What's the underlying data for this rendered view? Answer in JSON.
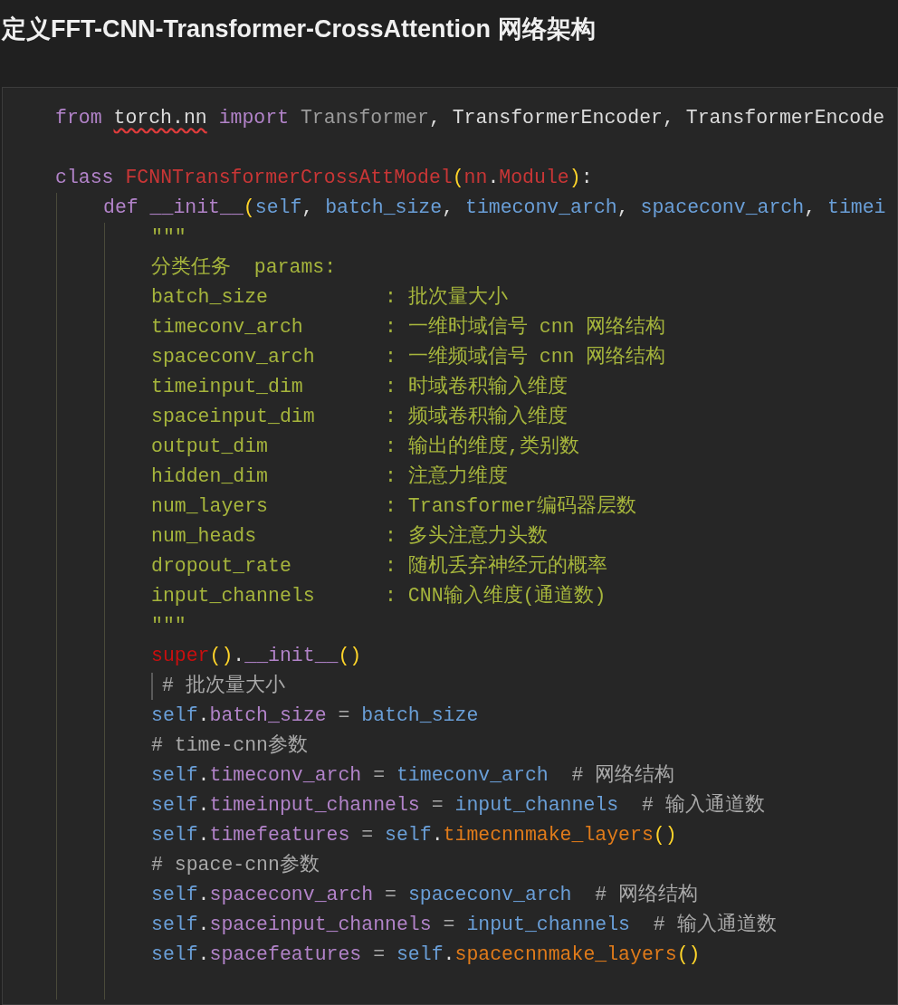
{
  "title": "定义FFT-CNN-Transformer-CrossAttention 网络架构",
  "code": [
    {
      "kind": "code",
      "tokens": [
        {
          "kind": "keyword",
          "text": "from "
        },
        {
          "kind": "error",
          "text": "torch.nn"
        },
        {
          "kind": "keyword",
          "text": " import "
        },
        {
          "kind": "unused",
          "text": "Transformer"
        },
        {
          "kind": "plain",
          "text": ", TransformerEncoder, TransformerEncode"
        }
      ]
    },
    {
      "kind": "blank"
    },
    {
      "kind": "code",
      "tokens": [
        {
          "kind": "keyword",
          "text": "class "
        },
        {
          "kind": "classname",
          "text": "FCNNTransformerCrossAttModel"
        },
        {
          "kind": "paren",
          "text": "("
        },
        {
          "kind": "classname",
          "text": "nn"
        },
        {
          "kind": "plain",
          "text": "."
        },
        {
          "kind": "classname",
          "text": "Module"
        },
        {
          "kind": "paren",
          "text": ")"
        },
        {
          "kind": "plain",
          "text": ":"
        }
      ],
      "children": [
        {
          "kind": "code",
          "tokens": [
            {
              "kind": "keyword",
              "text": "def "
            },
            {
              "kind": "member",
              "text": "__init__"
            },
            {
              "kind": "paren",
              "text": "("
            },
            {
              "kind": "param",
              "text": "self"
            },
            {
              "kind": "plain",
              "text": ", "
            },
            {
              "kind": "param",
              "text": "batch_size"
            },
            {
              "kind": "plain",
              "text": ", "
            },
            {
              "kind": "param",
              "text": "timeconv_arch"
            },
            {
              "kind": "plain",
              "text": ", "
            },
            {
              "kind": "param",
              "text": "spaceconv_arch"
            },
            {
              "kind": "plain",
              "text": ", "
            },
            {
              "kind": "param",
              "text": "timei"
            }
          ],
          "children": [
            {
              "kind": "code",
              "tokens": [
                {
                  "kind": "string",
                  "text": "\"\"\""
                }
              ]
            },
            {
              "kind": "code",
              "tokens": [
                {
                  "kind": "string",
                  "text": "分类任务  params:"
                }
              ]
            },
            {
              "kind": "code",
              "tokens": [
                {
                  "kind": "string",
                  "text": "batch_size          : 批次量大小"
                }
              ]
            },
            {
              "kind": "code",
              "tokens": [
                {
                  "kind": "string",
                  "text": "timeconv_arch       : 一维时域信号 cnn 网络结构"
                }
              ]
            },
            {
              "kind": "code",
              "tokens": [
                {
                  "kind": "string",
                  "text": "spaceconv_arch      : 一维频域信号 cnn 网络结构"
                }
              ]
            },
            {
              "kind": "code",
              "tokens": [
                {
                  "kind": "string",
                  "text": "timeinput_dim       : 时域卷积输入维度"
                }
              ]
            },
            {
              "kind": "code",
              "tokens": [
                {
                  "kind": "string",
                  "text": "spaceinput_dim      : 频域卷积输入维度"
                }
              ]
            },
            {
              "kind": "code",
              "tokens": [
                {
                  "kind": "string",
                  "text": "output_dim          : 输出的维度,类别数"
                }
              ]
            },
            {
              "kind": "code",
              "tokens": [
                {
                  "kind": "string",
                  "text": "hidden_dim          : 注意力维度"
                }
              ]
            },
            {
              "kind": "code",
              "tokens": [
                {
                  "kind": "string",
                  "text": "num_layers          : Transformer编码器层数"
                }
              ]
            },
            {
              "kind": "code",
              "tokens": [
                {
                  "kind": "string",
                  "text": "num_heads           : 多头注意力头数"
                }
              ]
            },
            {
              "kind": "code",
              "tokens": [
                {
                  "kind": "string",
                  "text": "dropout_rate        : 随机丢弃神经元的概率"
                }
              ]
            },
            {
              "kind": "code",
              "tokens": [
                {
                  "kind": "string",
                  "text": "input_channels      : CNN输入维度(通道数)"
                }
              ]
            },
            {
              "kind": "code",
              "tokens": [
                {
                  "kind": "string",
                  "text": "\"\"\""
                }
              ]
            },
            {
              "kind": "code",
              "tokens": [
                {
                  "kind": "builtin",
                  "text": "super"
                },
                {
                  "kind": "paren",
                  "text": "()"
                },
                {
                  "kind": "plain",
                  "text": "."
                },
                {
                  "kind": "member",
                  "text": "__init__"
                },
                {
                  "kind": "paren",
                  "text": "()"
                }
              ]
            },
            {
              "kind": "code",
              "cursor": true,
              "tokens": [
                {
                  "kind": "comment",
                  "text": "# 批次量大小"
                }
              ]
            },
            {
              "kind": "code",
              "tokens": [
                {
                  "kind": "param",
                  "text": "self"
                },
                {
                  "kind": "plain",
                  "text": "."
                },
                {
                  "kind": "member",
                  "text": "batch_size"
                },
                {
                  "kind": "op",
                  "text": " = "
                },
                {
                  "kind": "param",
                  "text": "batch_size"
                }
              ]
            },
            {
              "kind": "code",
              "tokens": [
                {
                  "kind": "comment",
                  "text": "# time-cnn参数"
                }
              ]
            },
            {
              "kind": "code",
              "tokens": [
                {
                  "kind": "param",
                  "text": "self"
                },
                {
                  "kind": "plain",
                  "text": "."
                },
                {
                  "kind": "member",
                  "text": "timeconv_arch"
                },
                {
                  "kind": "op",
                  "text": " = "
                },
                {
                  "kind": "param",
                  "text": "timeconv_arch"
                },
                {
                  "kind": "comment",
                  "text": "  # 网络结构"
                }
              ]
            },
            {
              "kind": "code",
              "tokens": [
                {
                  "kind": "param",
                  "text": "self"
                },
                {
                  "kind": "plain",
                  "text": "."
                },
                {
                  "kind": "member",
                  "text": "timeinput_channels"
                },
                {
                  "kind": "op",
                  "text": " = "
                },
                {
                  "kind": "param",
                  "text": "input_channels"
                },
                {
                  "kind": "comment",
                  "text": "  # 输入通道数"
                }
              ]
            },
            {
              "kind": "code",
              "tokens": [
                {
                  "kind": "param",
                  "text": "self"
                },
                {
                  "kind": "plain",
                  "text": "."
                },
                {
                  "kind": "member",
                  "text": "timefeatures"
                },
                {
                  "kind": "op",
                  "text": " = "
                },
                {
                  "kind": "param",
                  "text": "self"
                },
                {
                  "kind": "plain",
                  "text": "."
                },
                {
                  "kind": "function",
                  "text": "timecnnmake_layers"
                },
                {
                  "kind": "paren",
                  "text": "()"
                }
              ]
            },
            {
              "kind": "code",
              "tokens": [
                {
                  "kind": "comment",
                  "text": "# space-cnn参数"
                }
              ]
            },
            {
              "kind": "code",
              "tokens": [
                {
                  "kind": "param",
                  "text": "self"
                },
                {
                  "kind": "plain",
                  "text": "."
                },
                {
                  "kind": "member",
                  "text": "spaceconv_arch"
                },
                {
                  "kind": "op",
                  "text": " = "
                },
                {
                  "kind": "param",
                  "text": "spaceconv_arch"
                },
                {
                  "kind": "comment",
                  "text": "  # 网络结构"
                }
              ]
            },
            {
              "kind": "code",
              "tokens": [
                {
                  "kind": "param",
                  "text": "self"
                },
                {
                  "kind": "plain",
                  "text": "."
                },
                {
                  "kind": "member",
                  "text": "spaceinput_channels"
                },
                {
                  "kind": "op",
                  "text": " = "
                },
                {
                  "kind": "param",
                  "text": "input_channels"
                },
                {
                  "kind": "comment",
                  "text": "  # 输入通道数"
                }
              ]
            },
            {
              "kind": "code",
              "tokens": [
                {
                  "kind": "param",
                  "text": "self"
                },
                {
                  "kind": "plain",
                  "text": "."
                },
                {
                  "kind": "member",
                  "text": "spacefeatures"
                },
                {
                  "kind": "op",
                  "text": " = "
                },
                {
                  "kind": "param",
                  "text": "self"
                },
                {
                  "kind": "plain",
                  "text": "."
                },
                {
                  "kind": "function",
                  "text": "spacecnnmake_layers"
                },
                {
                  "kind": "paren",
                  "text": "()"
                }
              ]
            },
            {
              "kind": "blank"
            }
          ]
        }
      ]
    }
  ]
}
